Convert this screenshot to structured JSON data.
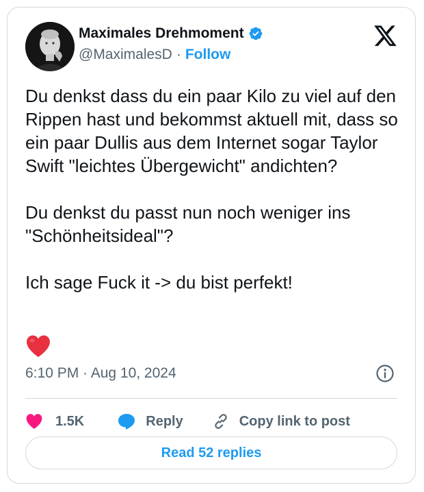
{
  "author": {
    "name": "Maximales Drehmoment",
    "handle": "@MaximalesD",
    "separator": "·",
    "follow_label": "Follow",
    "verified": true
  },
  "tweet": {
    "text": "Du denkst dass du ein paar Kilo zu viel auf den Rippen hast und bekommst aktuell mit, dass so ein paar Dullis aus dem Internet sogar Taylor Swift \"leichtes Übergewicht\" andichten?\n\nDu denkst du passt nun noch weniger ins \"Schönheitsideal\"?\n\nIch sage Fuck it -> du bist perfekt!",
    "emoji": "red-heart",
    "timestamp": "6:10 PM · Aug 10, 2024"
  },
  "actions": {
    "likes": "1.5K",
    "reply_label": "Reply",
    "copy_label": "Copy link to post"
  },
  "read_replies_label": "Read 52 replies",
  "colors": {
    "accent": "#1d9bf0",
    "like": "#f91880",
    "text": "#0f1419",
    "secondary": "#536471",
    "border": "#cfd9de"
  }
}
